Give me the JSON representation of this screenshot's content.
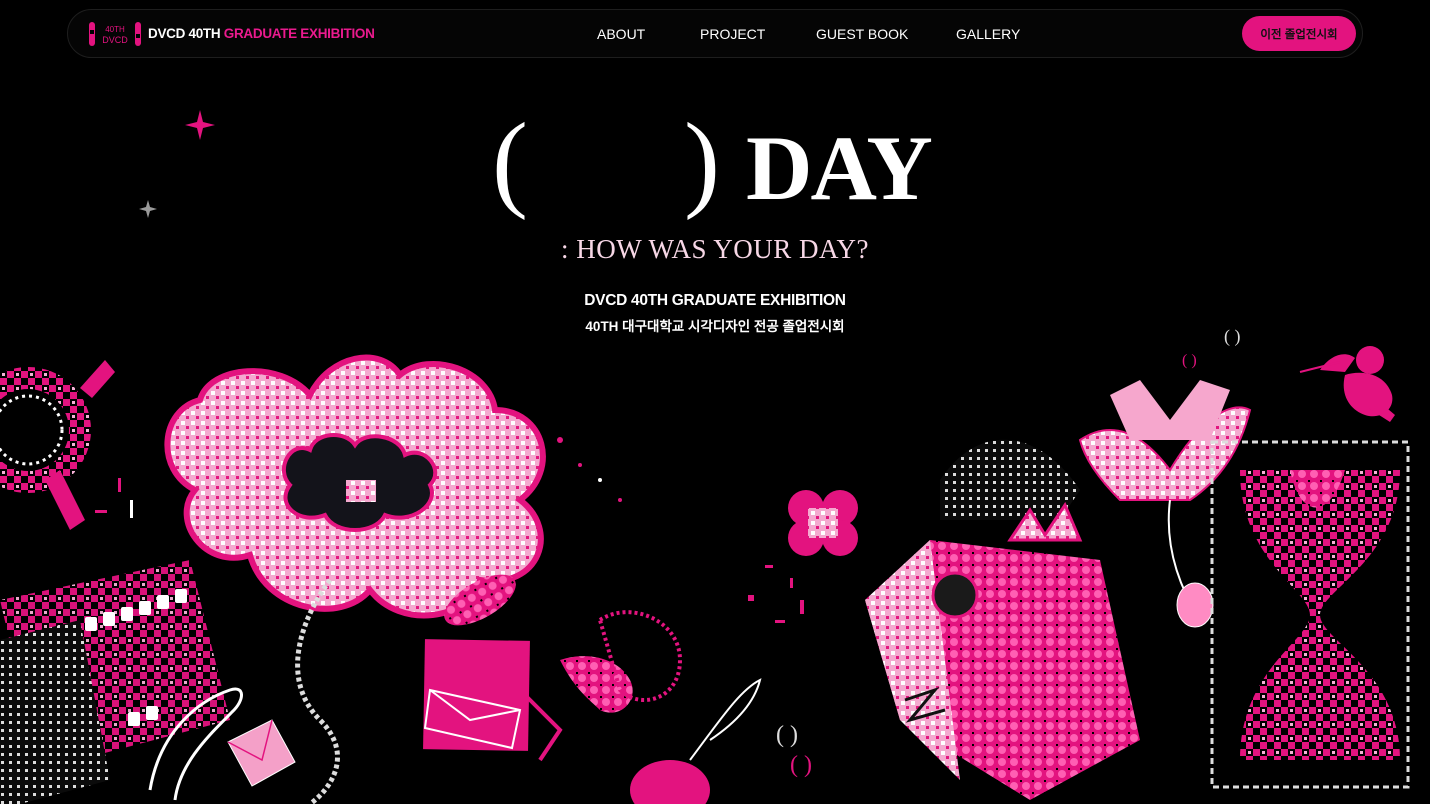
{
  "brand": {
    "white": "DVCD 40TH ",
    "pink": "GRADUATE EXHIBITION",
    "logo_alt": "40TH DVCD"
  },
  "nav": {
    "items": [
      {
        "label": "ABOUT"
      },
      {
        "label": "PROJECT"
      },
      {
        "label": "GUEST BOOK"
      },
      {
        "label": "GALLERY"
      }
    ],
    "prev_button": "이전 졸업전시회"
  },
  "hero": {
    "paren_left": "(",
    "paren_right": ")",
    "day": "DAY",
    "subtitle": ": HOW WAS YOUR DAY?",
    "title_en": "DVCD 40TH GRADUATE EXHIBITION",
    "title_ko": "40TH 대구대학교 시각디자인 전공 졸업전시회"
  },
  "colors": {
    "accent": "#e3137f",
    "pink_light": "#f7b3d6",
    "background": "#000000"
  },
  "icons": [
    "sparkle-icon",
    "flower-icon",
    "cupid-icon",
    "envelope-icon",
    "crown-icon",
    "hourglass-icon",
    "film-strip-icon",
    "lotus-icon",
    "pixel-heart-icon"
  ]
}
